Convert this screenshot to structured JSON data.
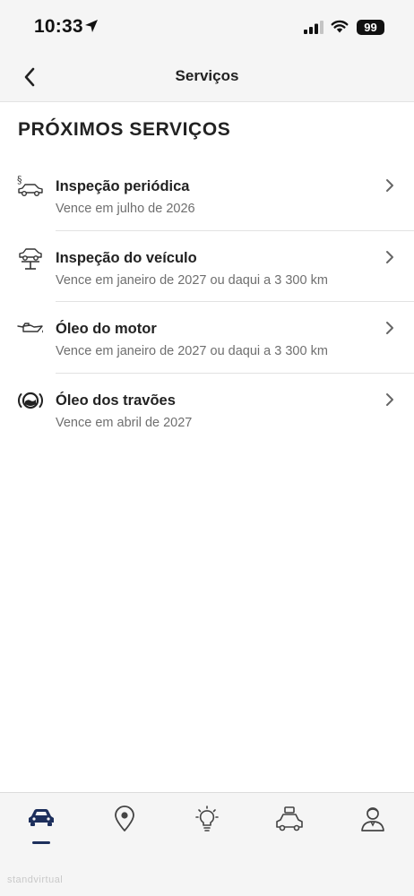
{
  "status_bar": {
    "time": "10:33",
    "battery": "99"
  },
  "nav": {
    "title": "Serviços"
  },
  "section": {
    "heading": "PRÓXIMOS SERVIÇOS"
  },
  "services": [
    {
      "title": "Inspeção periódica",
      "subtitle": "Vence em julho de 2026",
      "icon": "periodic-inspection-icon"
    },
    {
      "title": "Inspeção do veículo",
      "subtitle": "Vence em janeiro de 2027 ou daqui a 3 300 km",
      "icon": "car-lift-icon"
    },
    {
      "title": "Óleo do motor",
      "subtitle": "Vence em janeiro de 2027 ou daqui a 3 300 km",
      "icon": "oil-can-icon"
    },
    {
      "title": "Óleo dos travões",
      "subtitle": "Vence em abril de 2027",
      "icon": "brake-fluid-icon"
    }
  ],
  "tab_bar": {
    "tabs": [
      "car-icon",
      "location-pin-icon",
      "lightbulb-icon",
      "car-services-icon",
      "profile-icon"
    ],
    "active_tab": "car-icon",
    "active_color": "#1d2f5c"
  },
  "watermark": "standvirtual"
}
